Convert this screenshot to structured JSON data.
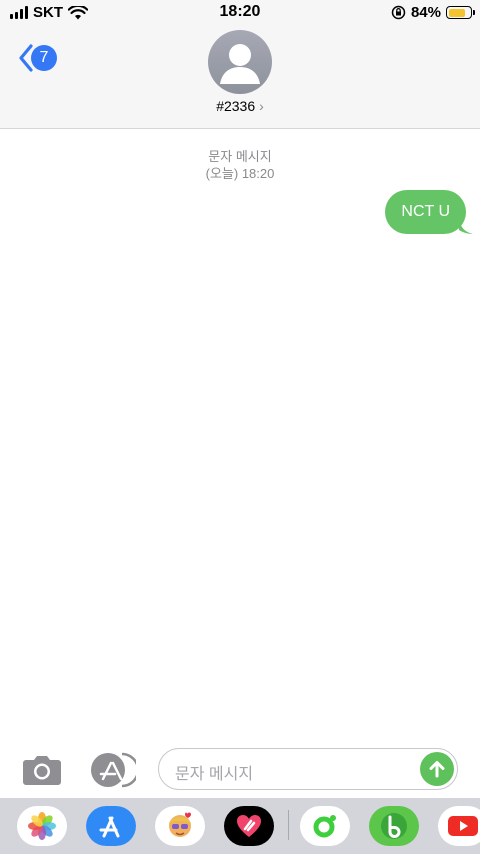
{
  "status_bar": {
    "carrier": "SKT",
    "time": "18:20",
    "battery_percent": "84%",
    "battery_level": 0.84,
    "icons": [
      "cellular-signal-icon",
      "wifi-icon",
      "orientation-lock-icon",
      "battery-icon"
    ]
  },
  "header": {
    "back_badge_count": "7",
    "contact_name": "#2336",
    "chevron": "›"
  },
  "conversation": {
    "service_label": "문자 메시지",
    "timestamp": "(오늘) 18:20",
    "messages": [
      {
        "text": "NCT U",
        "direction": "outgoing",
        "color": "#65c466"
      }
    ]
  },
  "composer": {
    "placeholder": "문자 메시지",
    "send_color": "#5fc15b"
  },
  "app_drawer": {
    "apps": [
      "photos-app-icon",
      "app-store-icon",
      "memoji-icon",
      "digital-touch-icon",
      "green-app-icon",
      "b-app-icon",
      "youtube-app-icon"
    ]
  },
  "colors": {
    "accent_blue": "#3478f6",
    "bubble_green": "#65c466"
  }
}
